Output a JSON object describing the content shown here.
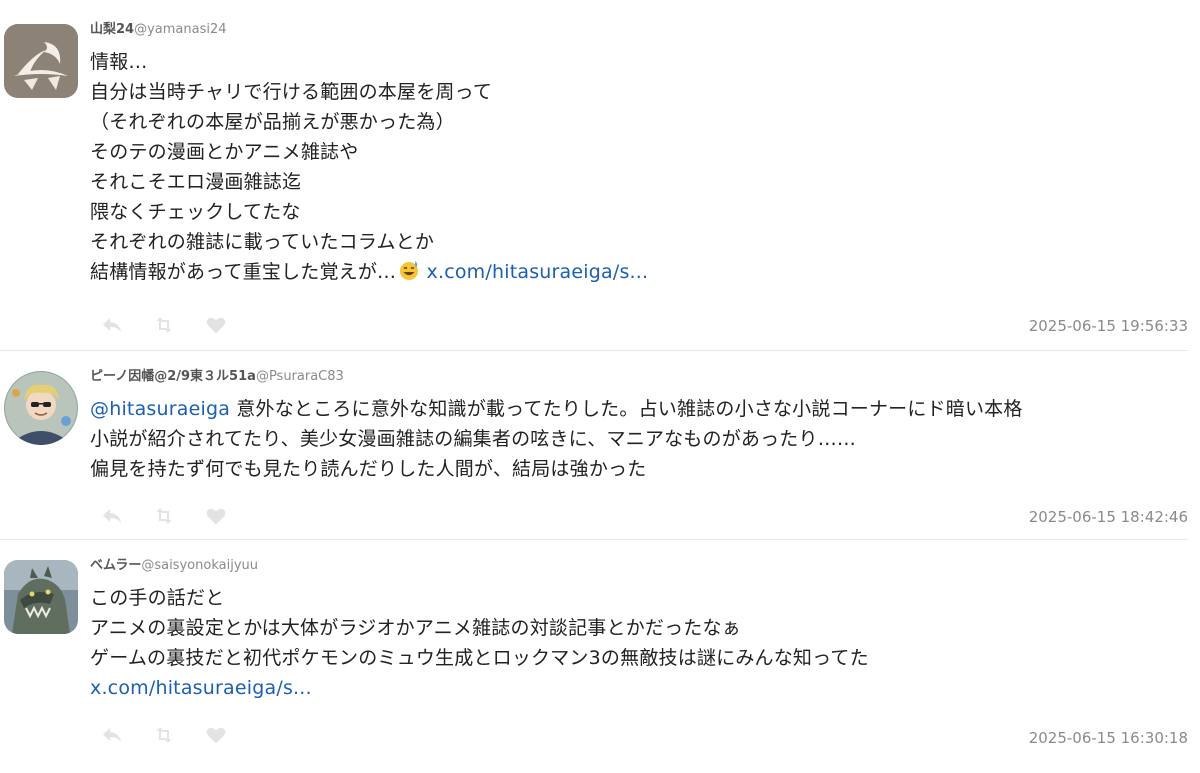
{
  "tweets": [
    {
      "name": "山梨24",
      "handle": "@yamanasi24",
      "lines": [
        "情報…",
        "自分は当時チャリで行ける範囲の本屋を周って",
        "（それぞれの本屋が品揃えが悪かった為）",
        "そのテの漫画とかアニメ雑誌や",
        "それこそエロ漫画雑誌迄",
        "隈なくチェックしてたな",
        "それぞれの雑誌に載っていたコラムとか",
        "結構情報があって重宝した覚えが…"
      ],
      "link": "x.com/hitasuraeiga/s...",
      "emoji": "sweat-smile-emoji",
      "time": "2025-06-15 19:56:33"
    },
    {
      "name": "ピーノ因幡@2/9東３ル51a",
      "handle": "@PsuraraC83",
      "mention": "@hitasuraeiga",
      "line1": " 意外なところに意外な知識が載ってたりした。占い雑誌の小さな小説コーナーにド暗い本格",
      "line2": "小説が紹介されてたり、美少女漫画雑誌の編集者の呟きに、マニアなものがあったり……",
      "line3": "偏見を持たず何でも見たり読んだりした人間が、結局は強かった",
      "time": "2025-06-15 18:42:46"
    },
    {
      "name": "ベムラー",
      "handle": "@saisyonokaijyuu",
      "lines": [
        "この手の話だと",
        "アニメの裏設定とかは大体がラジオかアニメ雑誌の対談記事とかだったなぁ",
        "ゲームの裏技だと初代ポケモンのミュウ生成とロックマン3の無敵技は謎にみんな知ってた"
      ],
      "link": "x.com/hitasuraeiga/s...",
      "time": "2025-06-15 16:30:18"
    }
  ],
  "actions": {
    "reply_icon": "reply-icon",
    "retweet_icon": "retweet-icon",
    "like_icon": "heart-icon",
    "icon_color": "#e3e3e3"
  },
  "colors": {
    "link": "#1a5fb4",
    "meta": "#8a8a8a",
    "divider": "#e8e8e8"
  }
}
